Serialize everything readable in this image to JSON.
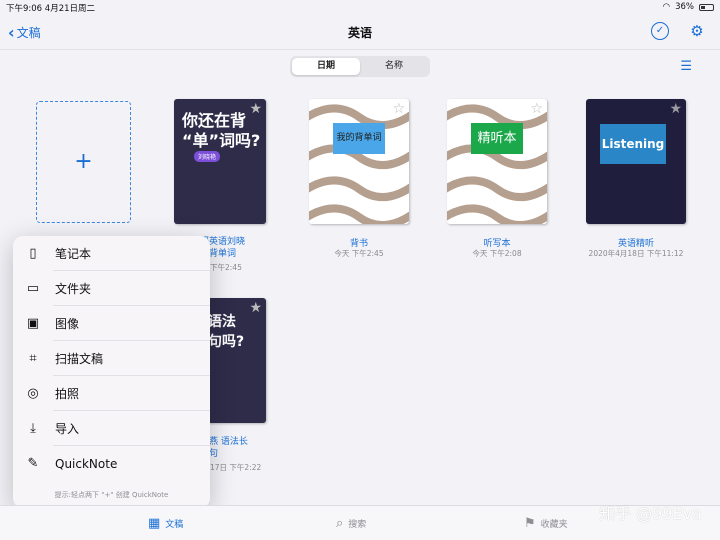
{
  "status": {
    "time_date": "下午9:06   4月21日周二",
    "battery": "36%"
  },
  "nav": {
    "back_label": "文稿",
    "title": "英语"
  },
  "segments": [
    "日期",
    "名称"
  ],
  "docs": [
    {
      "cover_text": "你还在背\n“单”词吗?",
      "badge": "刘晓艳",
      "title": "研英语刘晓\n在背单词",
      "date": "下午2:45"
    },
    {
      "cover_text": "我的背单词",
      "title": "背书",
      "date": "今天 下午2:45"
    },
    {
      "cover_text": "精听本",
      "title": "听写本",
      "date": "今天 下午2:08"
    },
    {
      "cover_text": "Listening",
      "title": "英语精听",
      "date": "2020年4月18日 下午11:12"
    },
    {
      "cover_text": "是语法\n难句吗?",
      "title": "晓燕 语法长\n难句",
      "date": "17日 下午2:22"
    }
  ],
  "popover": {
    "items": [
      {
        "label": "笔记本",
        "icon": "notebook-icon"
      },
      {
        "label": "文件夹",
        "icon": "folder-icon"
      },
      {
        "label": "图像",
        "icon": "image-icon"
      },
      {
        "label": "扫描文稿",
        "icon": "scan-icon"
      },
      {
        "label": "拍照",
        "icon": "camera-icon"
      },
      {
        "label": "导入",
        "icon": "import-icon"
      },
      {
        "label": "QuickNote",
        "icon": "quicknote-icon"
      }
    ],
    "hint": "提示:轻点两下 \"+\" 创建 QuickNote"
  },
  "tabs": [
    "文稿",
    "搜索",
    "收藏夹"
  ],
  "watermark": "知乎 @99Eva",
  "colors": {
    "accent": "#1a6fd4"
  }
}
